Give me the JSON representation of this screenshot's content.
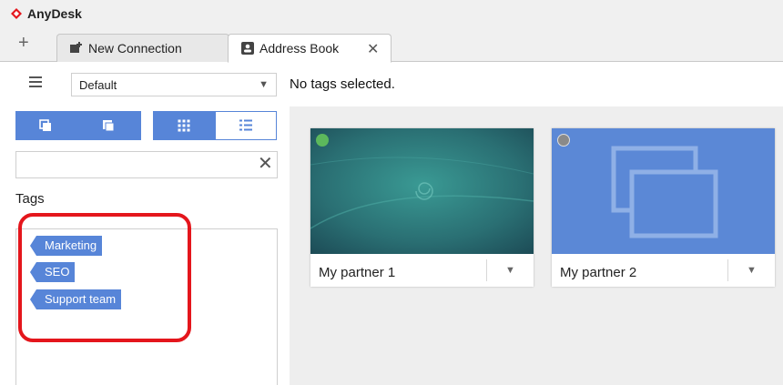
{
  "app": {
    "name": "AnyDesk",
    "brand_color": "#e4161c"
  },
  "tabs": [
    {
      "label": "New Connection",
      "icon": "new-connection-icon",
      "active": false
    },
    {
      "label": "Address Book",
      "icon": "address-book-icon",
      "active": true
    }
  ],
  "tab_actions": {
    "new_tab_icon": "plus-icon",
    "close_icon": "close-icon"
  },
  "left_panel": {
    "menu_icon": "hamburger-menu-icon",
    "address_book_select": {
      "value": "Default"
    },
    "view_toggles": [
      {
        "icon": "view-small-icon",
        "selected": true
      },
      {
        "icon": "view-large-icon",
        "selected": true
      },
      {
        "icon": "grid-view-icon",
        "selected": true
      },
      {
        "icon": "list-view-icon",
        "selected": false
      }
    ],
    "search": {
      "value": "",
      "placeholder": ""
    },
    "tags_title": "Tags",
    "tags": [
      "Marketing",
      "SEO",
      "Support team"
    ]
  },
  "main": {
    "status_text": "No tags selected.",
    "cards": [
      {
        "name": "My partner 1",
        "online": true,
        "status_color": "#5cb85c"
      },
      {
        "name": "My partner 2",
        "online": false,
        "status_color": "#8a8a8a"
      }
    ]
  },
  "colors": {
    "accent": "#5785d8",
    "highlight": "#e4161c",
    "card2_bg": "#5b88d6"
  }
}
